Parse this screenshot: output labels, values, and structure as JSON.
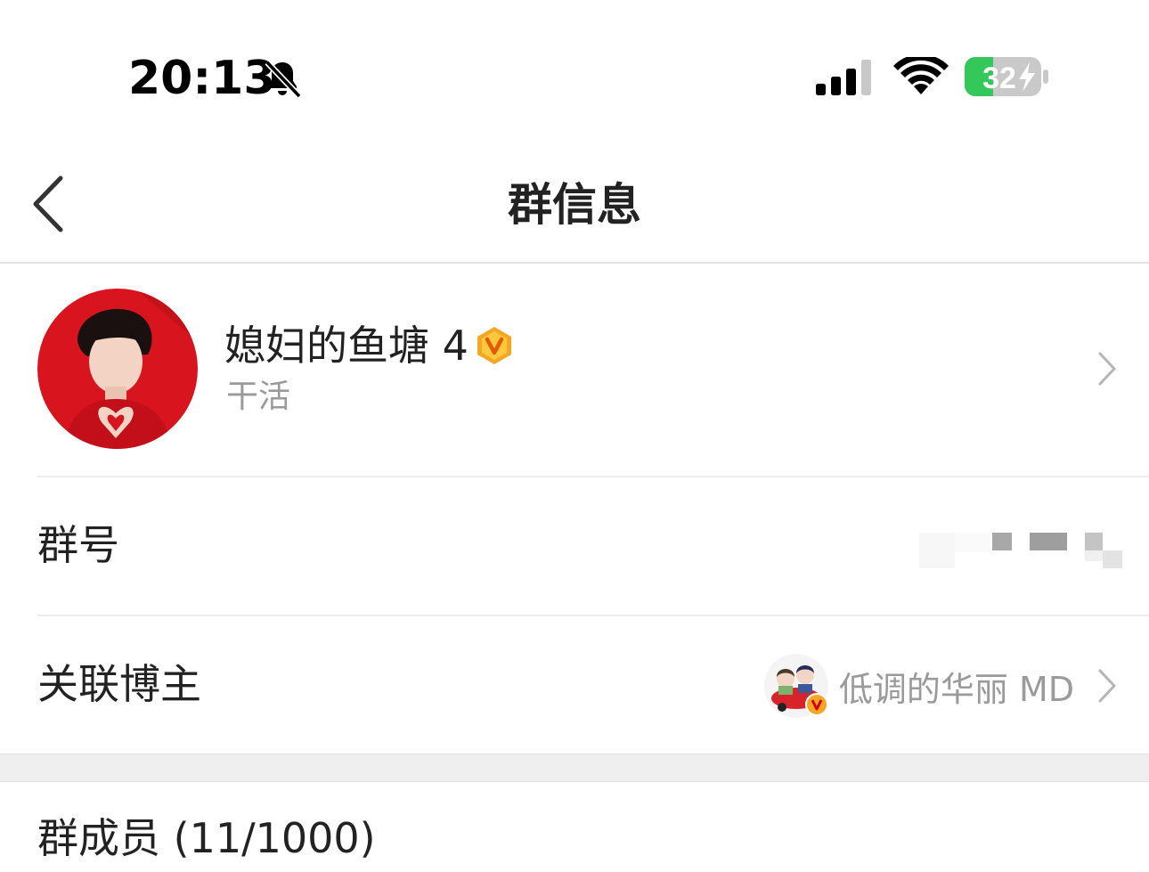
{
  "status_bar": {
    "time": "20:13",
    "silent_icon": "bell-slash-icon",
    "signal_icon": "cellular-signal-icon",
    "wifi_icon": "wifi-icon",
    "battery_percent": "32",
    "battery_charging": true,
    "battery_color": "#34c759"
  },
  "nav": {
    "back_icon": "chevron-left-icon",
    "title": "群信息"
  },
  "group": {
    "name": "媳妇的鱼塘 4",
    "subtitle": "干活",
    "badge_icon": "vip-badge-icon",
    "badge_color": "#f5a623",
    "avatar_bg": "#d8141f"
  },
  "group_number": {
    "label": "群号"
  },
  "linked_blogger": {
    "label": "关联博主",
    "name": "低调的华丽 MD"
  },
  "members": {
    "label": "群成员 (11/1000)"
  }
}
